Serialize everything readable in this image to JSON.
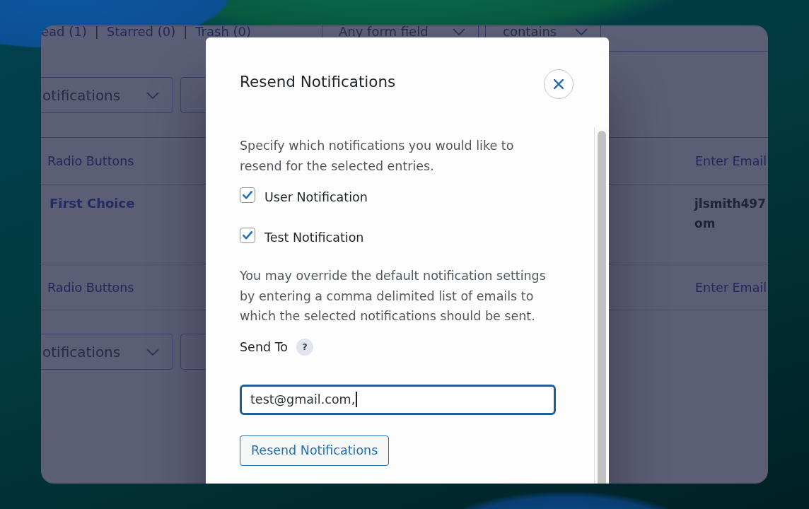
{
  "background_page": {
    "status_links": [
      {
        "kind": "link",
        "text": "ead (1)"
      },
      {
        "kind": "separator",
        "text": "|"
      },
      {
        "kind": "link",
        "text": "Starred (0)"
      },
      {
        "kind": "separator",
        "text": "|"
      },
      {
        "kind": "link",
        "text": "Trash (0)"
      }
    ],
    "filters": [
      {
        "label": "Any form field"
      },
      {
        "label": "contains"
      }
    ],
    "bulk_actions_top": {
      "selected_action": "otifications"
    },
    "table": {
      "columns": [
        {
          "label": "Radio Buttons"
        },
        {
          "label": "Enter Email"
        }
      ],
      "rows": [
        {
          "cells": [
            {
              "lines": [
                "First Choice"
              ]
            },
            {
              "lines": [
                "jlsmith497",
                "om"
              ]
            }
          ]
        }
      ],
      "footer_columns": [
        {
          "label": "Radio Buttons"
        },
        {
          "label": "Enter Email"
        }
      ]
    },
    "bulk_actions_bottom": {
      "selected_action": "otifications"
    }
  },
  "dialog": {
    "title": "Resend Notifications",
    "intro": "Specify which notifications you would like to resend for the selected entries.",
    "notifications": [
      {
        "label": "User Notification",
        "checked": true
      },
      {
        "label": "Test Notification",
        "checked": true
      }
    ],
    "override_text": "You may override the default notification settings by entering a comma delimited list of emails to which the selected notifications should be sent.",
    "send_to": {
      "label": "Send To",
      "help": "?",
      "value": "test@gmail.com,",
      "focused": true
    },
    "submit": "Resend Notifications"
  }
}
